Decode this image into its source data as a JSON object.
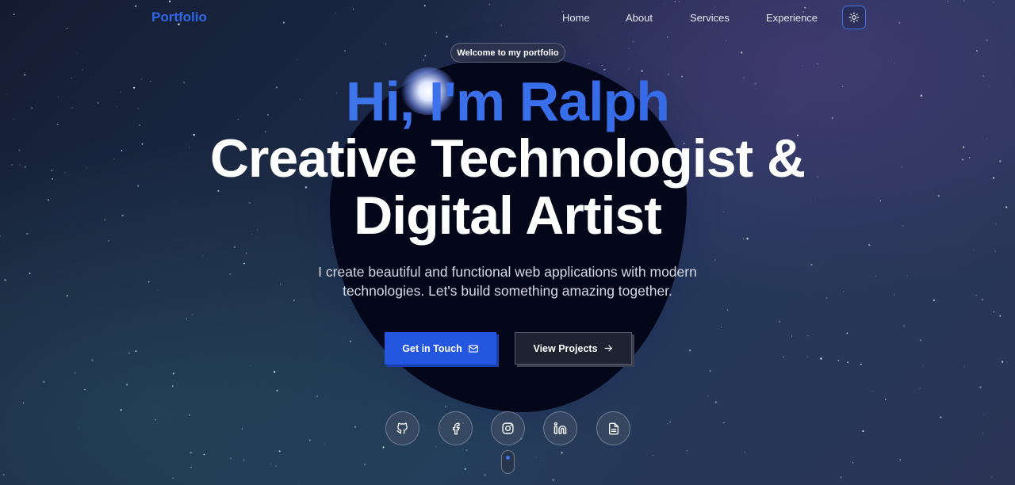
{
  "nav": {
    "brand": "Portfolio",
    "links": [
      "Home",
      "About",
      "Services",
      "Experience"
    ],
    "theme_toggle_icon": "sun-icon"
  },
  "hero": {
    "badge": "Welcome to my portfolio",
    "greeting": "Hi, I'm Ralph",
    "headline_line1": "Creative Technologist &",
    "headline_line2": "Digital Artist",
    "subtitle_line1": "I create beautiful and functional web applications with modern",
    "subtitle_line2": "technologies. Let's build something amazing together.",
    "primary_button": "Get in Touch",
    "primary_button_icon": "mail-icon",
    "secondary_button": "View Projects",
    "secondary_button_icon": "arrow-right-icon"
  },
  "social": [
    {
      "icon": "github-icon"
    },
    {
      "icon": "facebook-icon"
    },
    {
      "icon": "instagram-icon"
    },
    {
      "icon": "linkedin-icon"
    },
    {
      "icon": "resume-icon"
    }
  ],
  "colors": {
    "accent": "#2f67e8",
    "primary_button": "#2456e0",
    "blob": "#040719",
    "background": "#1c2a45"
  }
}
